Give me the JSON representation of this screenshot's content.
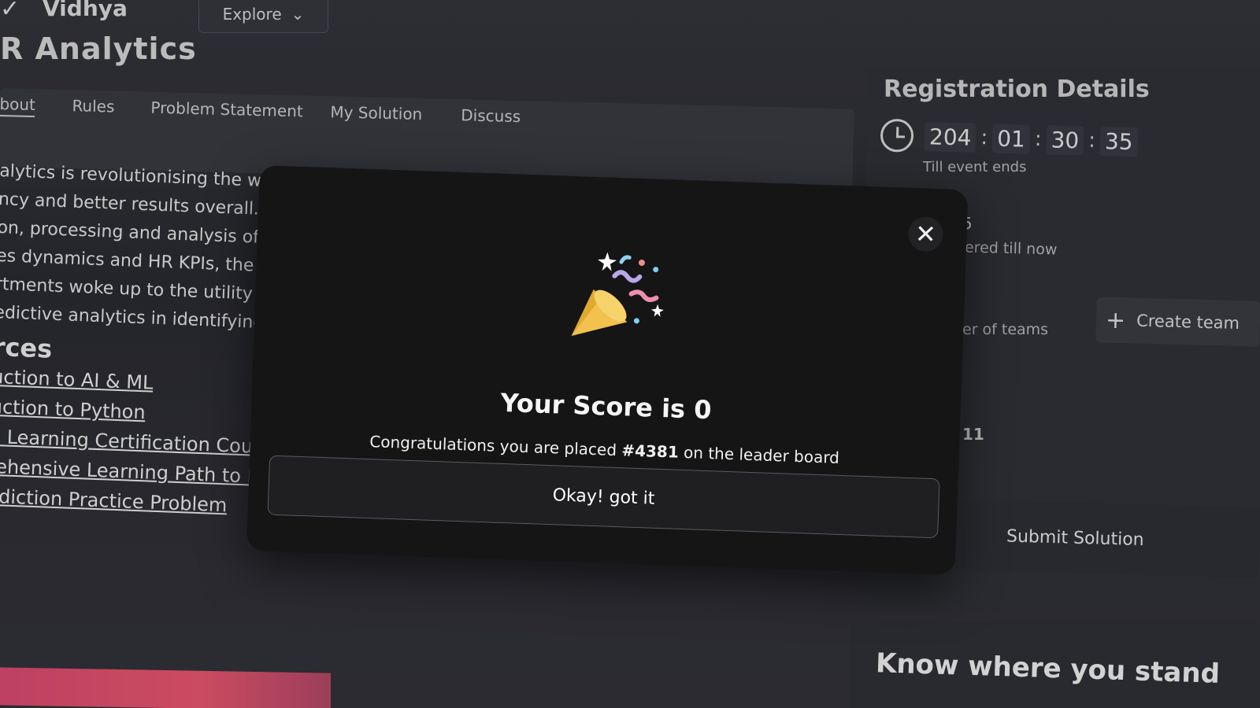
{
  "header": {
    "brand": "Vidhya",
    "explore_label": "Explore",
    "page_title": "R Analytics"
  },
  "tabs": [
    {
      "label": "bout",
      "active": true
    },
    {
      "label": "Rules"
    },
    {
      "label": "Problem Statement"
    },
    {
      "label": "My Solution"
    },
    {
      "label": "Discuss"
    }
  ],
  "about": {
    "lines": [
      "alytics is revolutionising the way h",
      "ncy and better results overall. Hum",
      "on, processing and analysis of da",
      "es dynamics and HR KPIs, the app",
      "rtments woke up to the utility o",
      "edictive analytics in identifying t"
    ]
  },
  "resources": {
    "heading": "rces",
    "links": [
      "uction to AI & ML",
      "uction to Python",
      "e Learning Certification Cours",
      "rehensive Learning Path to B",
      "ediction Practice Problem"
    ]
  },
  "sidebar": {
    "registration_title": "Registration Details",
    "timer": {
      "days": "204",
      "hours": "01",
      "minutes": "30",
      "seconds": "35",
      "label": "Till event ends"
    },
    "stat1_value": "5",
    "stat1_label": "ered till now",
    "stat2_label": "er of teams",
    "create_team_label": "Create team",
    "stat3_value": "11",
    "submit_label": "Submit Solution",
    "stand_title": "Know where you stand"
  },
  "modal": {
    "score_title": "Your Score is 0",
    "congrats_prefix": "Congratulations you are placed ",
    "rank": "#4381",
    "congrats_suffix": " on the leader board",
    "ok_label": "Okay! got it",
    "close_symbol": "✕"
  },
  "colors": {
    "modal_bg": "#151516",
    "accent_pink": "#e8566f",
    "party_popper": "#f2c14e"
  }
}
